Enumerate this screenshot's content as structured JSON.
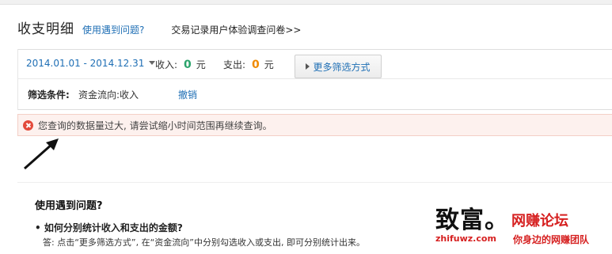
{
  "header": {
    "title": "收支明细",
    "help_link": "使用遇到问题?",
    "survey_link": "交易记录用户体验调查问卷>>"
  },
  "filter": {
    "date_range": "2014.01.01 - 2014.12.31",
    "income_label": "收入:",
    "income_value": "0",
    "income_unit": "元",
    "expense_label": "支出:",
    "expense_value": "0",
    "expense_unit": "元",
    "more_filters_label": "更多筛选方式",
    "condition_label": "筛选条件:",
    "condition_value": "资金流向:收入",
    "cancel_label": "撤销"
  },
  "alert": {
    "message": "您查询的数据量过大, 请尝试缩小时间范围再继续查询。"
  },
  "faq": {
    "title": "使用遇到问题?",
    "question": "• 如何分别统计收入和支出的金额?",
    "answer": "答: 点击“更多筛选方式”, 在“资金流向”中分别勾选收入或支出, 即可分别统计出来。"
  },
  "watermark": {
    "logo_text": "致富。",
    "logo_red": "网赚论坛",
    "url": "zhifuwz.com",
    "slogan": "你身边的网赚团队"
  },
  "colors": {
    "link": "#1f6fb5",
    "income": "#2aa36b",
    "expense": "#f08a00",
    "alert_bg": "#fdf1ee",
    "alert_icon": "#e34a3b"
  }
}
